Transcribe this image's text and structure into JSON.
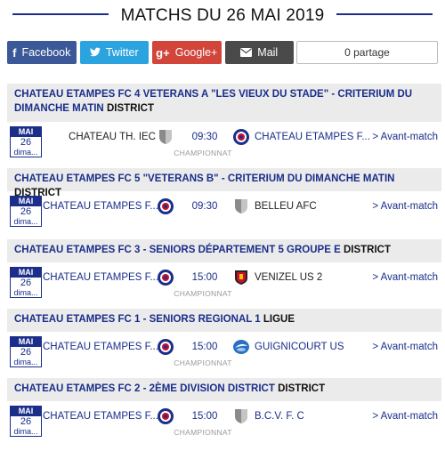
{
  "header": {
    "title": "MATCHS DU 26 MAI 2019"
  },
  "share": {
    "facebook": "Facebook",
    "twitter": "Twitter",
    "google": "Google+",
    "mail": "Mail",
    "count": "0 partage"
  },
  "sections": [
    {
      "title": "CHATEAU ETAMPES FC 4 VETERANS A \"LES VIEUX DU STADE\" - CRITERIUM DU DIMANCHE MATIN",
      "level": "DISTRICT",
      "match": {
        "month": "MAI",
        "day": "26",
        "weekday": "dima...",
        "home": "CHATEAU TH. IEC",
        "time": "09:30",
        "away": "CHATEAU ETAMPES F...",
        "competition": "CHAMPIONNAT",
        "link": "> Avant-match"
      }
    },
    {
      "title": "CHATEAU ETAMPES FC 5 \"VETERANS B\" - CRITERIUM DU DIMANCHE MATIN",
      "level": "DISTRICT",
      "match": {
        "month": "MAI",
        "day": "26",
        "weekday": "dima...",
        "home": "CHATEAU ETAMPES F...",
        "time": "09:30",
        "away": "BELLEU AFC",
        "competition": "",
        "link": "> Avant-match"
      }
    },
    {
      "title": "CHATEAU ETAMPES FC 3 - SENIORS DÉPARTEMENT 5 GROUPE E",
      "level": "DISTRICT",
      "match": {
        "month": "MAI",
        "day": "26",
        "weekday": "dima...",
        "home": "CHATEAU ETAMPES F...",
        "time": "15:00",
        "away": "VENIZEL US 2",
        "competition": "CHAMPIONNAT",
        "link": "> Avant-match"
      }
    },
    {
      "title": "CHATEAU ETAMPES FC 1 - SENIORS REGIONAL 1",
      "level": "LIGUE",
      "match": {
        "month": "MAI",
        "day": "26",
        "weekday": "dima...",
        "home": "CHATEAU ETAMPES F...",
        "time": "15:00",
        "away": "GUIGNICOURT US",
        "competition": "CHAMPIONNAT",
        "link": "> Avant-match"
      }
    },
    {
      "title": "CHATEAU ETAMPES FC 2 - 2ÈME DIVISION DISTRICT",
      "level": "DISTRICT",
      "match": {
        "month": "MAI",
        "day": "26",
        "weekday": "dima...",
        "home": "CHATEAU ETAMPES F...",
        "time": "15:00",
        "away": "B.C.V. F. C",
        "competition": "CHAMPIONNAT",
        "link": "> Avant-match"
      }
    }
  ]
}
